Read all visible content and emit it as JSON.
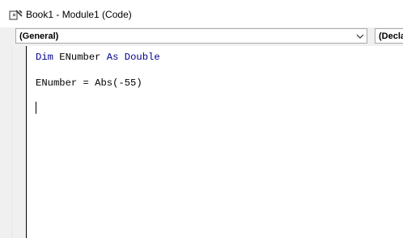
{
  "window": {
    "title": "Book1 - Module1 (Code)",
    "icon": "vba-code-window-icon"
  },
  "toolbar": {
    "object_combo": {
      "value": "(General)"
    },
    "procedure_combo": {
      "value": "(Decla"
    }
  },
  "code": {
    "line1": {
      "kw1": "Dim",
      "var": " ENumber ",
      "kw2": "As",
      "sp": " ",
      "kw3": "Double"
    },
    "line2": {
      "text": "ENumber = Abs(-55)"
    }
  },
  "colors": {
    "keyword": "#00008b",
    "text": "#000000",
    "margin": "#f0f0f0"
  }
}
